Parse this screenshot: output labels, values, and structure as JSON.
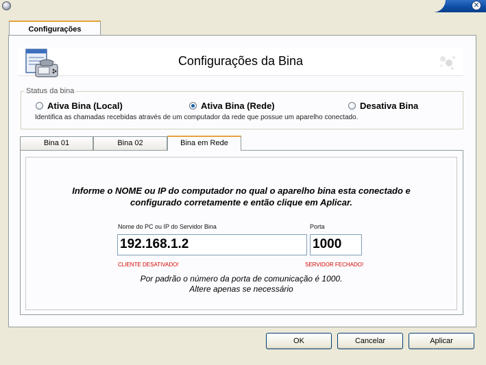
{
  "window": {
    "close_glyph": "✕"
  },
  "outer_tab": {
    "label": "Configurações"
  },
  "header": {
    "title": "Configurações da Bina",
    "icon": "fax-phone-icon"
  },
  "status": {
    "legend": "Status da bina",
    "options": [
      {
        "label": "Ativa Bina (Local)",
        "selected": false
      },
      {
        "label": "Ativa Bina (Rede)",
        "selected": true
      },
      {
        "label": "Desativa Bina",
        "selected": false
      }
    ],
    "description": "Identifica as chamadas recebidas através de um computador da rede que possue um aparelho conectado."
  },
  "tabs": [
    {
      "label": "Bina 01",
      "active": false
    },
    {
      "label": "Bina 02",
      "active": false
    },
    {
      "label": "Bina em Rede",
      "active": true
    }
  ],
  "network": {
    "instruction_line1": "Informe o NOME ou IP do computador no qual o aparelho bina esta conectado e",
    "instruction_line2": "configurado corretamente e então clique em Aplicar.",
    "host_label": "Nome do PC ou IP do Servidor Bina",
    "host_value": "192.168.1.2",
    "port_label": "Porta",
    "port_value": "1000",
    "client_status": "CLIENTE DESATIVADO!",
    "server_status": "SERVIDOR FECHADO!",
    "note_line1": "Por padrão o número da porta de comunicação é 1000.",
    "note_line2": "Altere apenas se necessário"
  },
  "buttons": {
    "ok": "OK",
    "cancel": "Cancelar",
    "apply": "Aplicar"
  },
  "colors": {
    "error": "#d40000",
    "accent": "#e7a237",
    "title_blue": "#0f4fa6"
  }
}
